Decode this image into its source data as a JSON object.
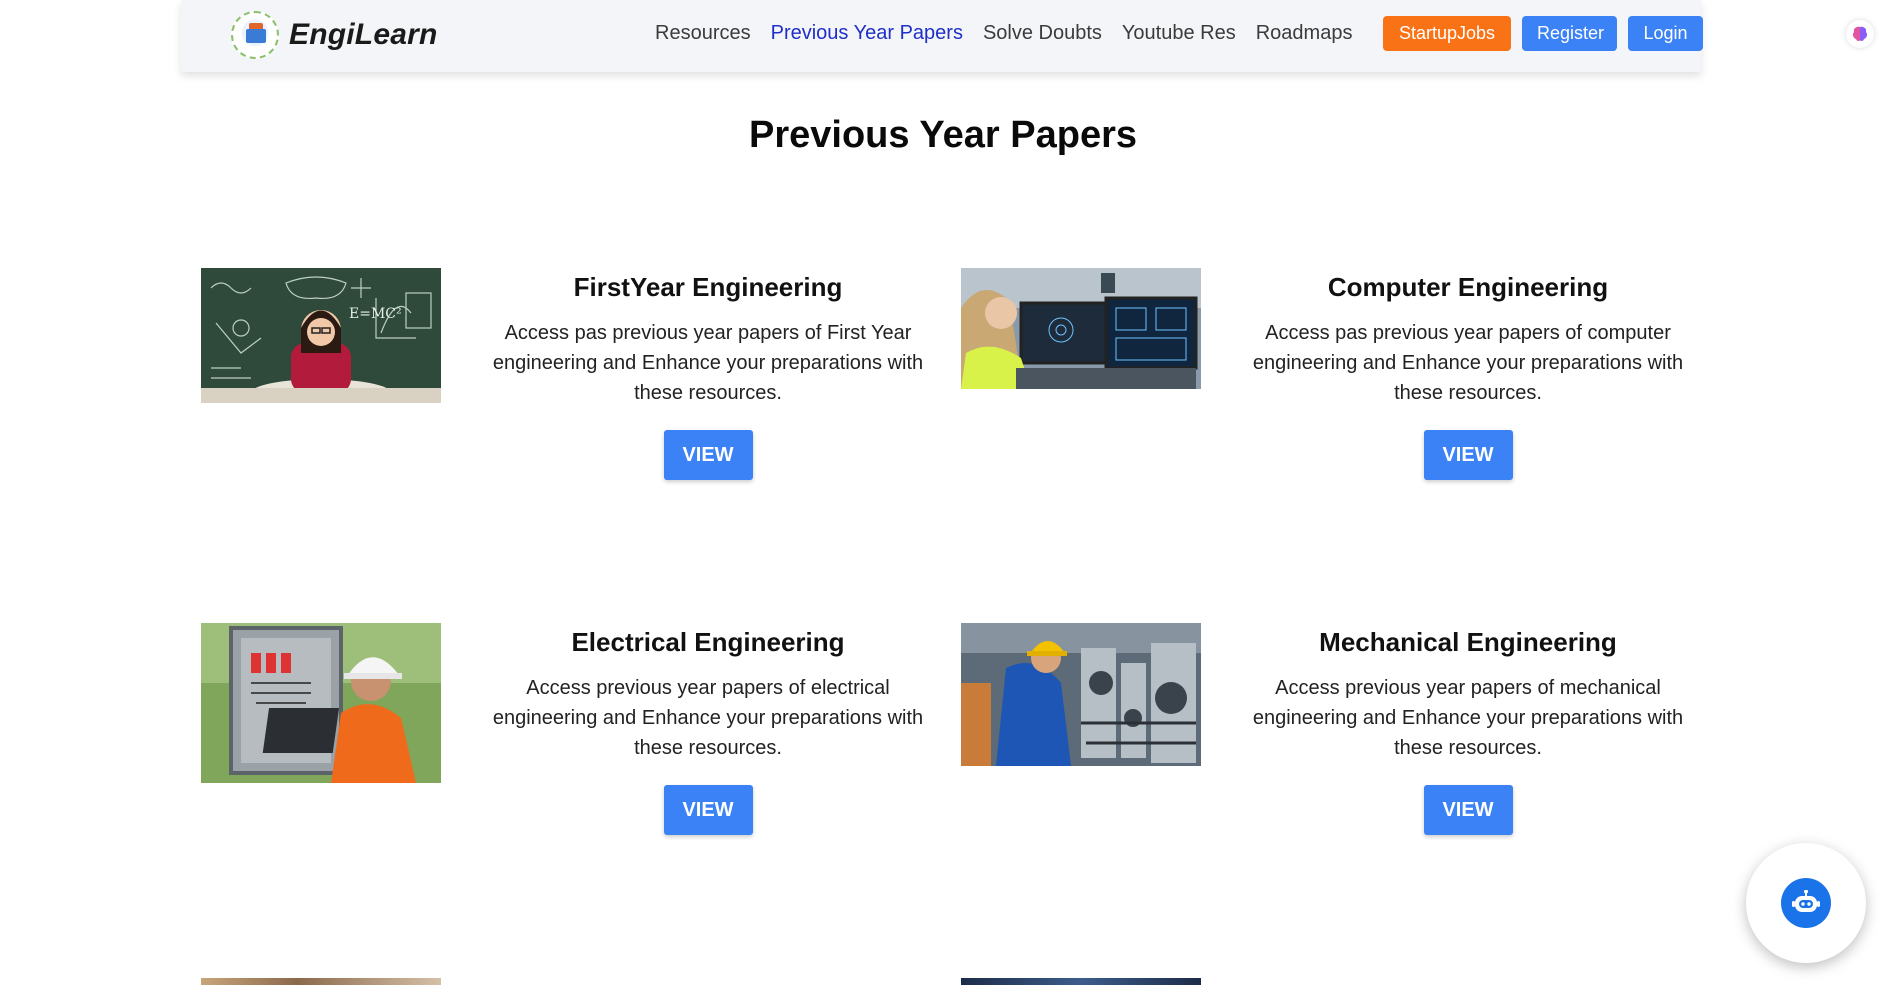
{
  "brand": {
    "name": "EngiLearn"
  },
  "nav": {
    "links": [
      "Resources",
      "Previous Year Papers",
      "Solve Doubts",
      "Youtube Res",
      "Roadmaps"
    ],
    "active": "Previous Year Papers",
    "buttons": {
      "startup": "StartupJobs",
      "register": "Register",
      "login": "Login"
    }
  },
  "page": {
    "title": "Previous Year Papers"
  },
  "cards": [
    {
      "title": "FirstYear Engineering",
      "description": "Access pas previous year papers of First Year engineering and Enhance your preparations with these resources.",
      "button": "VIEW"
    },
    {
      "title": "Computer Engineering",
      "description": "Access pas previous year papers of computer engineering and Enhance your preparations with these resources.",
      "button": "VIEW"
    },
    {
      "title": "Electrical Engineering",
      "description": "Access previous year papers of electrical engineering and Enhance your preparations with these resources.",
      "button": "VIEW"
    },
    {
      "title": "Mechanical Engineering",
      "description": "Access previous year papers of mechanical engineering and Enhance your preparations with these resources.",
      "button": "VIEW"
    }
  ],
  "icons": {
    "logo": "engilearn-logo-icon",
    "brain": "brain-icon",
    "chatbot": "chatbot-icon"
  },
  "colors": {
    "accent_blue": "#3b82f6",
    "accent_orange": "#f97316",
    "active_link": "#1f2fc7"
  }
}
